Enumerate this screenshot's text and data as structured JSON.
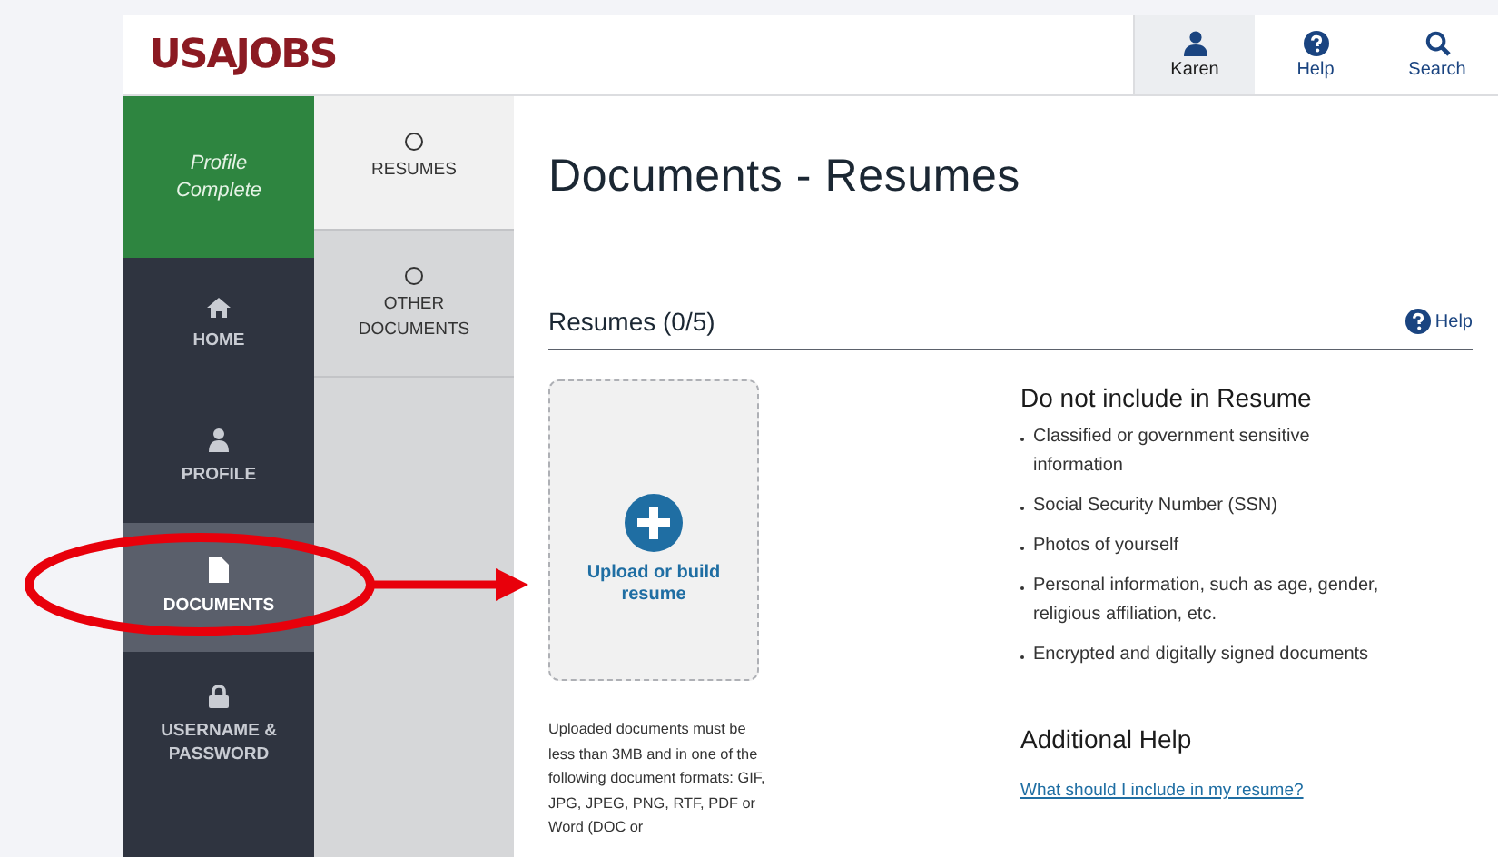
{
  "header": {
    "logo": "USAJOBS",
    "nav": [
      {
        "label": "Karen",
        "selected": true
      },
      {
        "label": "Help",
        "selected": false
      },
      {
        "label": "Search",
        "selected": false
      }
    ]
  },
  "sidebar": {
    "status": "Profile Complete",
    "items": [
      {
        "label": "HOME",
        "selected": false
      },
      {
        "label": "PROFILE",
        "selected": false
      },
      {
        "label": "DOCUMENTS",
        "selected": true
      },
      {
        "label": "USERNAME & PASSWORD",
        "selected": false
      }
    ]
  },
  "subnav": [
    {
      "label": "RESUMES",
      "selected": true
    },
    {
      "label": "OTHER DOCUMENTS",
      "selected": false
    }
  ],
  "page_title": "Documents - Resumes",
  "section": {
    "title": "Resumes (0/5)",
    "help": "Help"
  },
  "upload": {
    "label": "Upload or build resume",
    "note": "Uploaded documents must be less than 3MB and in one of the following document formats: GIF, JPG, JPEG, PNG, RTF, PDF or Word (DOC or"
  },
  "exclusions": {
    "title": "Do not include in Resume",
    "items": [
      "Classified or government sensitive information",
      "Social Security Number (SSN)",
      "Photos of yourself",
      "Personal information, such as age, gender, religious affiliation, etc.",
      "Encrypted and digitally signed documents"
    ]
  },
  "additional_help": {
    "title": "Additional Help",
    "link": "What should I include in my resume?"
  }
}
